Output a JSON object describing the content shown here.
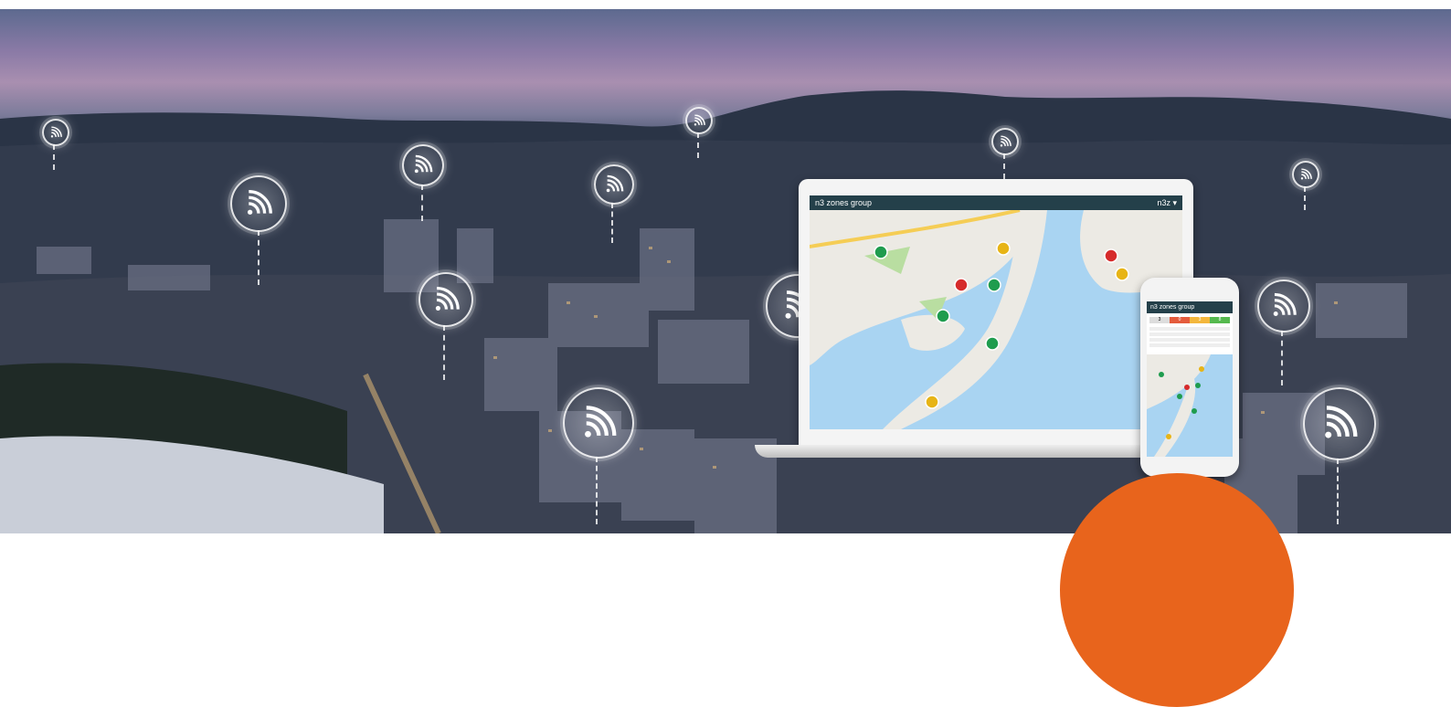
{
  "hero": {
    "alt": "City skyline at dusk with wireless sensor beacons"
  },
  "laptop_app": {
    "logo": "n3 zones group",
    "user": "n3z ▾"
  },
  "phone_app": {
    "logo": "n3 zones group",
    "status": [
      "3",
      "0",
      "3",
      "8"
    ]
  },
  "colors": {
    "app_bar": "#24404a",
    "pin_green": "#1f9c4e",
    "pin_red": "#d62b2b",
    "pin_yellow": "#e7b416",
    "accent_orange": "#e8641c"
  },
  "icons": [
    "wifi-signal-icon",
    "home-icon",
    "user-icon"
  ]
}
